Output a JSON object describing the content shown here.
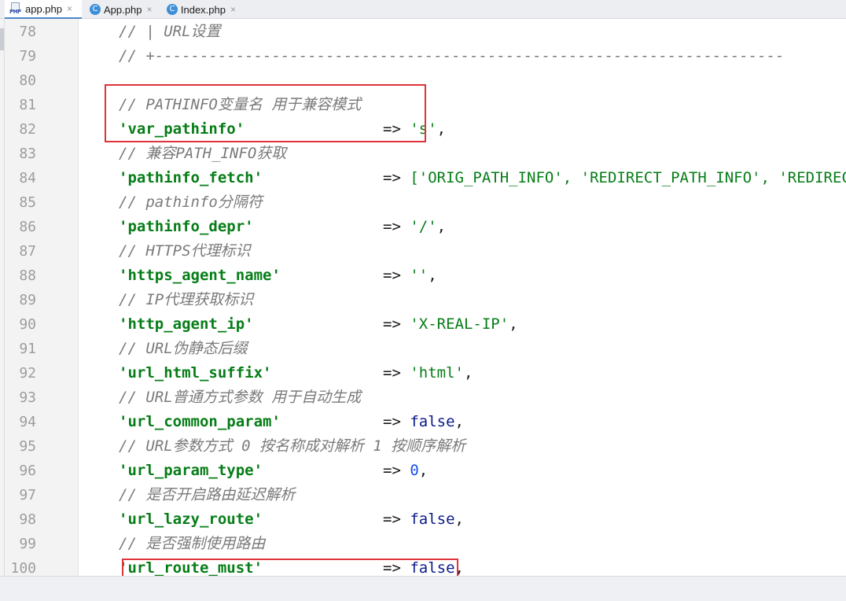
{
  "tabs": [
    {
      "label": "app.php",
      "icon": "php-file-icon",
      "active": true
    },
    {
      "label": "App.php",
      "icon": "class-icon",
      "active": false
    },
    {
      "label": "Index.php",
      "icon": "class-icon",
      "active": false
    }
  ],
  "close_glyph": "×",
  "class_glyph": "C",
  "php_glyph": "PHP",
  "lines": [
    {
      "no": "78",
      "comment": "// | URL设置"
    },
    {
      "no": "79",
      "comment": "// +----------------------------------------------------------------------"
    },
    {
      "no": "80"
    },
    {
      "no": "81",
      "comment": "// PATHINFO变量名 用于兼容模式"
    },
    {
      "no": "82",
      "key": "'var_pathinfo'",
      "arrow": "=>",
      "value": "'s'",
      "value_type": "str",
      "tail": ","
    },
    {
      "no": "83",
      "comment": "// 兼容PATH_INFO获取"
    },
    {
      "no": "84",
      "key": "'pathinfo_fetch'",
      "arrow": "=>",
      "value": "['ORIG_PATH_INFO', 'REDIRECT_PATH_INFO', 'REDIRECT_URL']",
      "value_type": "str",
      "tail": ","
    },
    {
      "no": "85",
      "comment": "// pathinfo分隔符"
    },
    {
      "no": "86",
      "key": "'pathinfo_depr'",
      "arrow": "=>",
      "value": "'/'",
      "value_type": "str",
      "tail": ","
    },
    {
      "no": "87",
      "comment": "// HTTPS代理标识"
    },
    {
      "no": "88",
      "key": "'https_agent_name'",
      "arrow": "=>",
      "value": "''",
      "value_type": "str",
      "tail": ","
    },
    {
      "no": "89",
      "comment": "// IP代理获取标识"
    },
    {
      "no": "90",
      "key": "'http_agent_ip'",
      "arrow": "=>",
      "value": "'X-REAL-IP'",
      "value_type": "str",
      "tail": ","
    },
    {
      "no": "91",
      "comment": "// URL伪静态后缀"
    },
    {
      "no": "92",
      "key": "'url_html_suffix'",
      "arrow": "=>",
      "value": "'html'",
      "value_type": "str",
      "tail": ","
    },
    {
      "no": "93",
      "comment": "// URL普通方式参数 用于自动生成"
    },
    {
      "no": "94",
      "key": "'url_common_param'",
      "arrow": "=>",
      "value": "false",
      "value_type": "kw",
      "tail": ","
    },
    {
      "no": "95",
      "comment": "// URL参数方式 0 按名称成对解析 1 按顺序解析"
    },
    {
      "no": "96",
      "key": "'url_param_type'",
      "arrow": "=>",
      "value": "0",
      "value_type": "num",
      "tail": ","
    },
    {
      "no": "97",
      "comment": "// 是否开启路由延迟解析"
    },
    {
      "no": "98",
      "key": "'url_lazy_route'",
      "arrow": "=>",
      "value": "false",
      "value_type": "kw",
      "tail": ","
    },
    {
      "no": "99",
      "comment": "// 是否强制使用路由"
    },
    {
      "no": "100",
      "key": "'url_route_must'",
      "arrow": "=>",
      "value": "false",
      "value_type": "kw",
      "tail": ","
    }
  ],
  "colors": {
    "highlight_box": "#e0323a",
    "string": "#067d17",
    "keyword": "#0c1a8c",
    "number": "#1750eb",
    "comment": "#7a7a7a"
  }
}
